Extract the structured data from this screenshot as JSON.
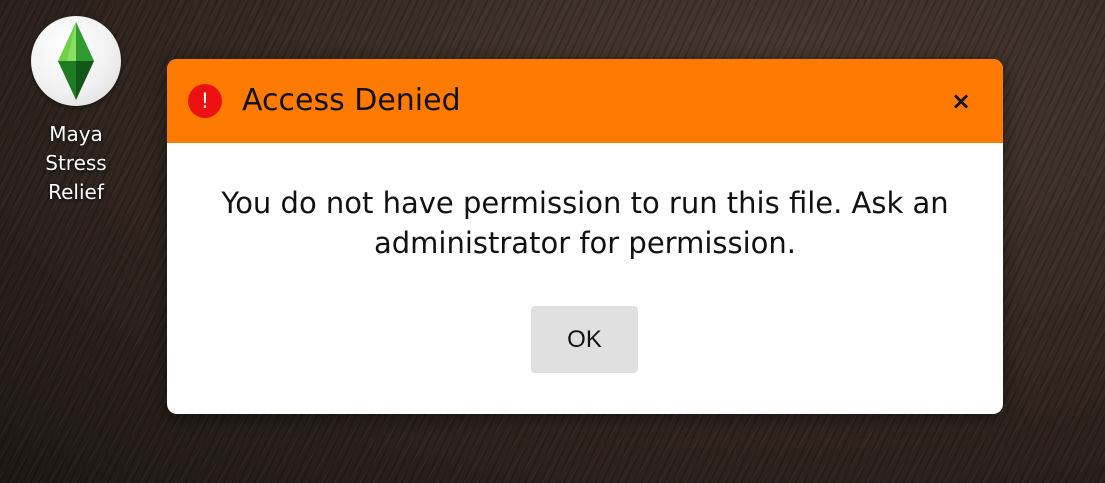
{
  "desktop": {
    "icons": [
      {
        "label_lines": [
          "Maya",
          "Stress",
          "Relief"
        ],
        "icon": "plumbob-icon"
      }
    ]
  },
  "dialog": {
    "title": "Access Denied",
    "icon": "error-icon",
    "icon_glyph": "!",
    "close_glyph": "×",
    "message": "You do not have permission to run this file. Ask an administrator for permission.",
    "ok_label": "OK",
    "colors": {
      "header": "#ff7a00",
      "error_icon": "#ee1111",
      "ok_button": "#e0e0e0"
    }
  }
}
